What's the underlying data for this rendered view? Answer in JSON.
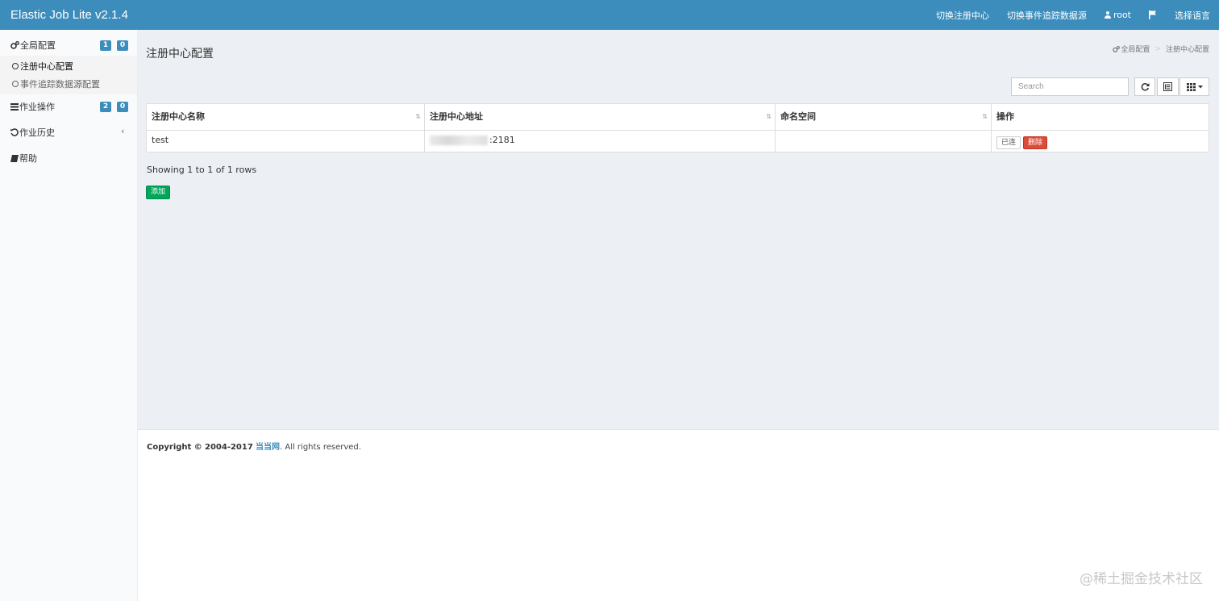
{
  "header": {
    "brand": "Elastic Job Lite v2.1.4",
    "nav": {
      "switch_registry": "切换注册中心",
      "switch_event_source": "切换事件追踪数据源",
      "user": "root",
      "language": "选择语言"
    }
  },
  "sidebar": {
    "global_config": {
      "label": "全局配置",
      "badge_a": "1",
      "badge_b": "0"
    },
    "sub_items": [
      {
        "label": "注册中心配置",
        "active": true
      },
      {
        "label": "事件追踪数据源配置",
        "active": false
      }
    ],
    "job_ops": {
      "label": "作业操作",
      "badge_a": "2",
      "badge_b": "0"
    },
    "job_history": {
      "label": "作业历史",
      "chevron": "‹"
    },
    "help": {
      "label": "帮助"
    }
  },
  "main": {
    "title": "注册中心配置",
    "breadcrumb": [
      "全局配置",
      "注册中心配置"
    ],
    "search_placeholder": "Search",
    "table": {
      "columns": [
        "注册中心名称",
        "注册中心地址",
        "命名空间",
        "操作"
      ],
      "rows": [
        {
          "name": "test",
          "address": ":2181",
          "namespace": "",
          "connected_label": "已连",
          "delete_label": "删除"
        }
      ]
    },
    "pagination_info": "Showing 1 to 1 of 1 rows",
    "add_label": "添加"
  },
  "footer": {
    "prefix": "Copyright ©",
    "years": "2004-2017",
    "company": "当当网",
    "suffix": ". All rights reserved."
  },
  "watermark": "@稀土掘金技术社区",
  "colors": {
    "header_bg": "#3c8dbc",
    "badge": "#3c8dbc",
    "danger": "#dd4b39",
    "success": "#00a65a",
    "content_bg": "#ecf0f5"
  }
}
